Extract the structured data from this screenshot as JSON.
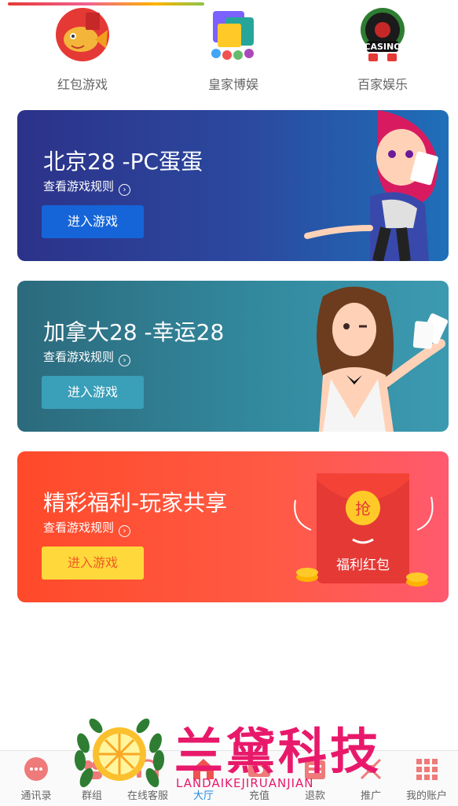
{
  "quick_links": [
    {
      "label": "红包游戏",
      "icon": "red-envelope-fish-icon"
    },
    {
      "label": "皇家博娱",
      "icon": "bingo-icon"
    },
    {
      "label": "百家娱乐",
      "icon": "casino-icon",
      "icon_text": "CASINO"
    }
  ],
  "cards": [
    {
      "title": "北京28 -PC蛋蛋",
      "rule": "查看游戏规则",
      "button": "进入游戏",
      "art": "red-haired-card-girl"
    },
    {
      "title": "加拿大28 -幸运28",
      "rule": "查看游戏规则",
      "button": "进入游戏",
      "art": "dealer-girl-with-cards"
    },
    {
      "title": "精彩福利-玩家共享",
      "rule": "查看游戏规则",
      "button": "进入游戏",
      "art": "red-envelope",
      "art_text_top": "抢",
      "art_text_bottom": "福利红包"
    }
  ],
  "tabbar": [
    {
      "label": "通讯录",
      "icon": "contacts-icon",
      "active": false
    },
    {
      "label": "群组",
      "icon": "group-icon",
      "active": false
    },
    {
      "label": "在线客服",
      "icon": "support-icon",
      "active": false
    },
    {
      "label": "大厅",
      "icon": "home-icon",
      "active": true
    },
    {
      "label": "充值",
      "icon": "recharge-icon",
      "active": false
    },
    {
      "label": "退款",
      "icon": "refund-icon",
      "active": false
    },
    {
      "label": "推广",
      "icon": "promote-icon",
      "active": false
    },
    {
      "label": "我的账户",
      "icon": "account-icon",
      "active": false
    }
  ],
  "watermark": {
    "brand": "兰黛科技",
    "subtitle": "LANDAIKEJIRUANJIAN"
  },
  "colors": {
    "accent": "#1565d8",
    "tab_active": "#1e88e5",
    "watermark": "#e8196b"
  }
}
